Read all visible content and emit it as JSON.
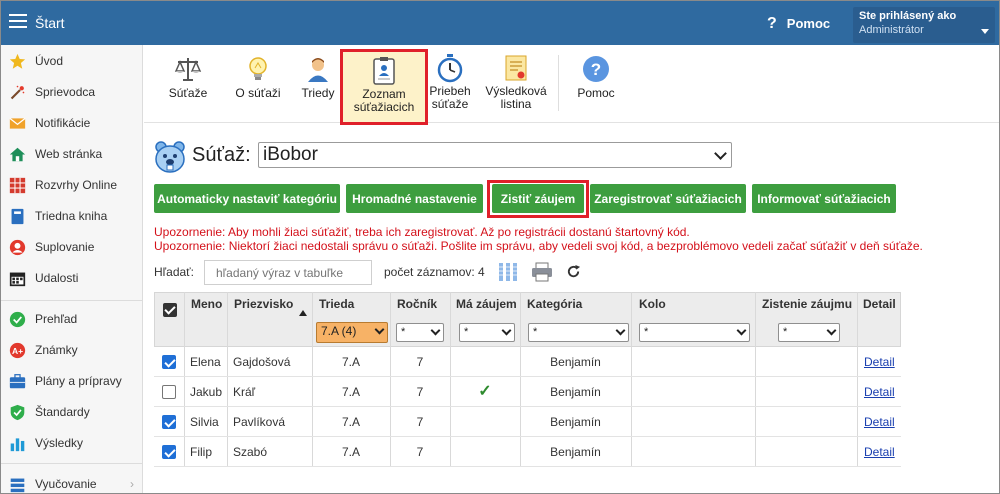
{
  "app": {
    "title": "Štart"
  },
  "header": {
    "help_label": "Pomoc",
    "login_label": "Ste prihlásený ako",
    "login_user": "Administrátor"
  },
  "sidebar": {
    "items": [
      {
        "label": "Úvod",
        "icon": "star-icon"
      },
      {
        "label": "Sprievodca",
        "icon": "magic-wand-icon"
      },
      {
        "label": "Notifikácie",
        "icon": "envelope-icon"
      },
      {
        "label": "Web stránka",
        "icon": "home-icon"
      },
      {
        "label": "Rozvrhy Online",
        "icon": "calendar-grid-icon"
      },
      {
        "label": "Triedna kniha",
        "icon": "book-icon"
      },
      {
        "label": "Suplovanie",
        "icon": "person-icon"
      },
      {
        "label": "Udalosti",
        "icon": "calendar-icon"
      },
      {
        "label": "Prehľad",
        "icon": "check-circle-icon"
      },
      {
        "label": "Známky",
        "icon": "grade-icon"
      },
      {
        "label": "Plány a prípravy",
        "icon": "briefcase-icon"
      },
      {
        "label": "Štandardy",
        "icon": "shield-check-icon"
      },
      {
        "label": "Výsledky",
        "icon": "bar-chart-icon"
      },
      {
        "label": "Vyučovanie",
        "icon": "stack-icon"
      }
    ]
  },
  "toolbar": {
    "items": [
      {
        "label": "Súťaže",
        "icon": "scales-icon"
      },
      {
        "label": "O súťaži",
        "icon": "lightbulb-icon"
      },
      {
        "label": "Triedy",
        "icon": "student-icon"
      },
      {
        "label": "Zoznam súťažiacich",
        "label_line1": "Zoznam",
        "label_line2": "súťažiacich",
        "icon": "clipboard-user-icon",
        "active": true
      },
      {
        "label": "Priebeh súťaže",
        "label_line1": "Priebeh",
        "label_line2": "súťaže",
        "icon": "stopwatch-icon"
      },
      {
        "label": "Výsledková listina",
        "label_line1": "Výsledková",
        "label_line2": "listina",
        "icon": "certificate-icon"
      },
      {
        "label": "Pomoc",
        "icon": "help-circle-icon"
      }
    ]
  },
  "competition": {
    "label": "Súťaž:",
    "selected": "iBobor"
  },
  "actions": {
    "auto_category": "Automaticky nastaviť kategóriu",
    "bulk_settings": "Hromadné nastavenie",
    "find_interest": "Zistiť záujem",
    "register": "Zaregistrovať súťažiacich",
    "inform": "Informovať súťažiacich"
  },
  "warnings": {
    "line1": "Upozornenie: Aby mohli žiaci súťažiť, treba ich zaregistrovať. Až po registrácii dostanú štartovný kód.",
    "line2": "Upozornenie: Niektorí žiaci nedostali správu o súťaži. Pošlite im správu, aby vedeli svoj kód, a bezproblémovo vedeli začať súťažiť v deň súťaže."
  },
  "search": {
    "label": "Hľadať:",
    "placeholder": "hľadaný výraz v tabuľke",
    "record_count_label": "počet záznamov: 4"
  },
  "table": {
    "columns": [
      "Meno",
      "Priezvisko",
      "Trieda",
      "Ročník",
      "Má záujem",
      "Kategória",
      "Kolo",
      "Zistenie záujmu",
      "Detail"
    ],
    "filters": {
      "trieda": "7.A (4)",
      "default": "*"
    },
    "rows": [
      {
        "checked": true,
        "meno": "Elena",
        "priezvisko": "Gajdošová",
        "trieda": "7.A",
        "rocnik": "7",
        "ma_zaujem": "",
        "kategoria": "Benjamín",
        "kolo": "",
        "zistenie": "",
        "detail": "Detail"
      },
      {
        "checked": false,
        "meno": "Jakub",
        "priezvisko": "Kráľ",
        "trieda": "7.A",
        "rocnik": "7",
        "ma_zaujem": "✓",
        "kategoria": "Benjamín",
        "kolo": "",
        "zistenie": "",
        "detail": "Detail"
      },
      {
        "checked": true,
        "meno": "Silvia",
        "priezvisko": "Pavlíková",
        "trieda": "7.A",
        "rocnik": "7",
        "ma_zaujem": "",
        "kategoria": "Benjamín",
        "kolo": "",
        "zistenie": "",
        "detail": "Detail"
      },
      {
        "checked": true,
        "meno": "Filip",
        "priezvisko": "Szabó",
        "trieda": "7.A",
        "rocnik": "7",
        "ma_zaujem": "",
        "kategoria": "Benjamín",
        "kolo": "",
        "zistenie": "",
        "detail": "Detail"
      }
    ]
  },
  "colors": {
    "topbar": "#2f6aa0",
    "button_green": "#3d9e3f",
    "highlight_red": "#e0202a",
    "warning_text": "#d4101a",
    "active_filter": "#f7b266"
  }
}
